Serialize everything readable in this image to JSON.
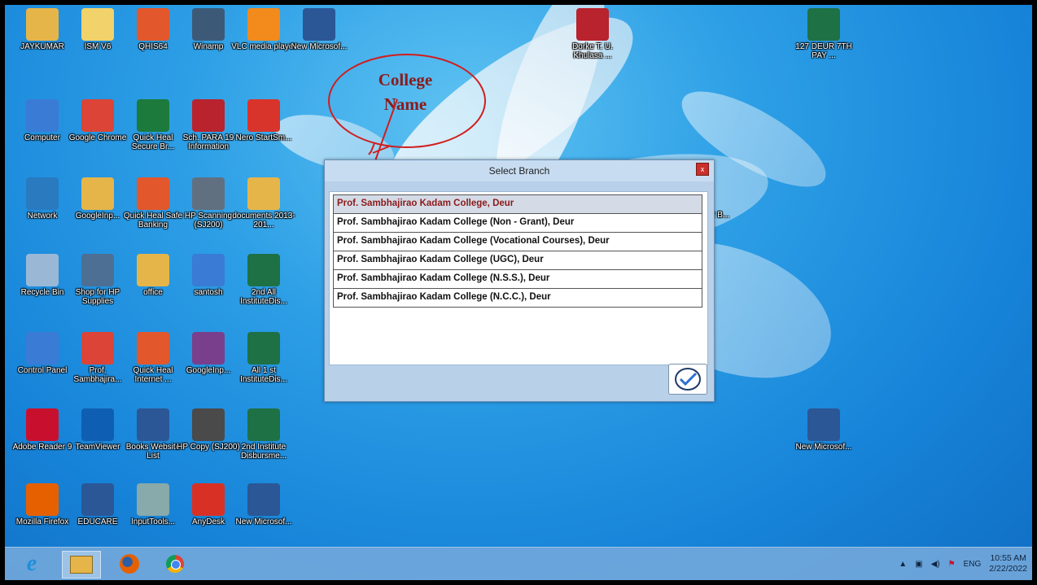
{
  "desktop": {
    "icons": [
      {
        "label": "JAYKUMAR",
        "icon": "folder-user-icon",
        "color": "#e6b54a"
      },
      {
        "label": "ISM V6",
        "icon": "info-app-icon",
        "color": "#f2d36b"
      },
      {
        "label": "QHIS64",
        "icon": "quickheal-icon",
        "color": "#e2572b"
      },
      {
        "label": "Winamp",
        "icon": "winamp-icon",
        "color": "#3c5a78"
      },
      {
        "label": "VLC media player",
        "icon": "vlc-cone-icon",
        "color": "#f28a1c"
      },
      {
        "label": "New Microsof...",
        "icon": "word-doc-icon",
        "color": "#2b5797"
      },
      {
        "label": "Computer",
        "icon": "computer-icon",
        "color": "#3a7bd5"
      },
      {
        "label": "Google Chrome",
        "icon": "chrome-icon",
        "color": "#db4437"
      },
      {
        "label": "Quick Heal Secure Br...",
        "icon": "secure-browser-icon",
        "color": "#1b7a3c"
      },
      {
        "label": "Sch. PARA 19 Information",
        "icon": "pdf-doc-icon",
        "color": "#b8232e"
      },
      {
        "label": "Nero StartSm...",
        "icon": "nero-icon",
        "color": "#d9342b"
      },
      {
        "label": "Network",
        "icon": "network-globe-icon",
        "color": "#2a7ac0"
      },
      {
        "label": "GoogleInp...",
        "icon": "folder-icon",
        "color": "#e6b54a"
      },
      {
        "label": "Quick Heal Safe Banking",
        "icon": "safe-banking-icon",
        "color": "#e2572b"
      },
      {
        "label": "HP Scanning (SJ200)",
        "icon": "scanner-icon",
        "color": "#607080"
      },
      {
        "label": "documents 2013-201...",
        "icon": "folder-shortcut-icon",
        "color": "#e6b54a"
      },
      {
        "label": "Recycle Bin",
        "icon": "recycle-bin-icon",
        "color": "#9ab8d6"
      },
      {
        "label": "Shop for HP Supplies",
        "icon": "printer-icon",
        "color": "#4c6f93"
      },
      {
        "label": "office",
        "icon": "folder-icon",
        "color": "#e6b54a"
      },
      {
        "label": "santosh",
        "icon": "computer-icon",
        "color": "#3a7bd5"
      },
      {
        "label": "2nd All InstituteDis...",
        "icon": "excel-doc-icon",
        "color": "#1e7145"
      },
      {
        "label": "Control Panel",
        "icon": "control-panel-icon",
        "color": "#3a7bd5"
      },
      {
        "label": "Prof. Sambhajira...",
        "icon": "chrome-profile-icon",
        "color": "#db4437"
      },
      {
        "label": "Quick Heal Internet ...",
        "icon": "quickheal-q-icon",
        "color": "#e2572b"
      },
      {
        "label": "GoogleInp...",
        "icon": "winrar-icon",
        "color": "#7a3f8c"
      },
      {
        "label": "All 1 st InstituteDis...",
        "icon": "excel-doc-icon",
        "color": "#1e7145"
      },
      {
        "label": "Adobe Reader 9",
        "icon": "adobe-reader-icon",
        "color": "#c8102e"
      },
      {
        "label": "TeamViewer",
        "icon": "teamviewer-icon",
        "color": "#0e5fb3"
      },
      {
        "label": "Books Website List",
        "icon": "word-doc-icon",
        "color": "#2b5797"
      },
      {
        "label": "HP Copy (SJ200)",
        "icon": "copier-icon",
        "color": "#4a4a4a"
      },
      {
        "label": "2nd Institute Disbursme...",
        "icon": "excel-doc-icon",
        "color": "#1e7145"
      },
      {
        "label": "Mozilla Firefox",
        "icon": "firefox-icon",
        "color": "#e66000"
      },
      {
        "label": "EDUCARE",
        "icon": "educare-icon",
        "color": "#2b5797"
      },
      {
        "label": "InputTools...",
        "icon": "input-tools-icon",
        "color": "#8aa"
      },
      {
        "label": "AnyDesk",
        "icon": "anydesk-icon",
        "color": "#d93025"
      },
      {
        "label": "New Microsof...",
        "icon": "word-doc-icon",
        "color": "#2b5797"
      },
      {
        "label": "Dorke T. U. Khulasa ...",
        "icon": "pdf-doc-icon",
        "color": "#b8232e"
      },
      {
        "label": "127 DEUR 7TH PAY ...",
        "icon": "excel-doc-icon",
        "color": "#1e7145"
      },
      {
        "label": "New Microsof...",
        "icon": "word-doc-icon",
        "color": "#2b5797"
      }
    ],
    "partial_label": "022 B..."
  },
  "callout": {
    "line1": "College",
    "line2": "Name",
    "color": "#8b1a1a"
  },
  "dialog": {
    "title": "Select Branch",
    "close_label": "x",
    "branches": [
      "Prof. Sambhajirao Kadam College, Deur",
      "Prof. Sambhajirao Kadam College (Non - Grant), Deur",
      "Prof. Sambhajirao Kadam College (Vocational Courses), Deur",
      "Prof. Sambhajirao Kadam College (UGC), Deur",
      "Prof. Sambhajirao Kadam College (N.S.S.), Deur",
      "Prof. Sambhajirao Kadam College (N.C.C.), Deur"
    ],
    "selected_index": 0,
    "ok_icon": "checkmark-circle-icon"
  },
  "taskbar": {
    "apps": [
      {
        "icon": "internet-explorer-icon",
        "color": "#1e8fd8"
      },
      {
        "icon": "file-explorer-icon",
        "color": "#e6b54a"
      },
      {
        "icon": "firefox-icon",
        "color": "#e66000"
      },
      {
        "icon": "chrome-icon",
        "color": "#db4437"
      }
    ],
    "tray": {
      "lang": "ENG",
      "time": "10:55 AM",
      "date": "2/22/2022"
    }
  }
}
